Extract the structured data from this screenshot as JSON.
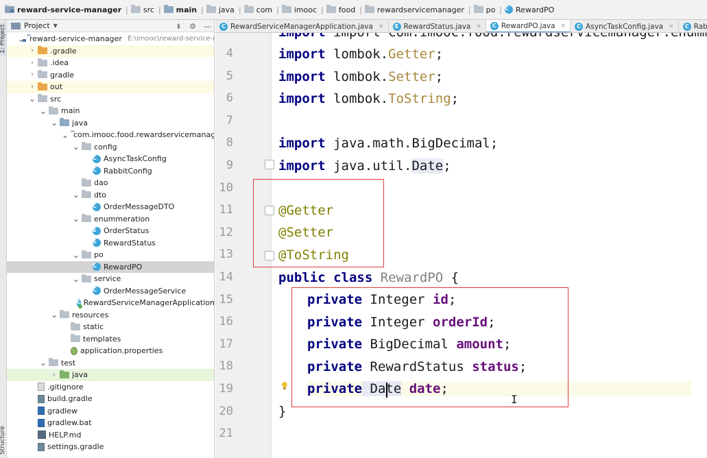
{
  "breadcrumb": [
    {
      "label": "reward-service-manager",
      "icon": "module-folder-icon"
    },
    {
      "label": "src",
      "icon": "folder-icon"
    },
    {
      "label": "main",
      "icon": "source-folder-icon"
    },
    {
      "label": "java",
      "icon": "folder-icon"
    },
    {
      "label": "com",
      "icon": "folder-icon"
    },
    {
      "label": "imooc",
      "icon": "folder-icon"
    },
    {
      "label": "food",
      "icon": "folder-icon"
    },
    {
      "label": "rewardservicemanager",
      "icon": "folder-icon"
    },
    {
      "label": "po",
      "icon": "folder-icon"
    },
    {
      "label": "RewardPO",
      "icon": "class-icon"
    }
  ],
  "sidebar_tabs": {
    "project": "1: Project",
    "structure": "Structure"
  },
  "project_panel": {
    "title": "Project",
    "tree": [
      {
        "label": "reward-service-manager",
        "hint": "E:\\imooc\\reward-service-man",
        "depth": 0,
        "arrow": "▾",
        "icon": "module"
      },
      {
        "label": ".gradle",
        "depth": 1,
        "arrow": "›",
        "icon": "orange",
        "hl": "yellow"
      },
      {
        "label": ".idea",
        "depth": 1,
        "arrow": "›",
        "icon": "folder"
      },
      {
        "label": "gradle",
        "depth": 1,
        "arrow": "›",
        "icon": "folder"
      },
      {
        "label": "out",
        "depth": 1,
        "arrow": "›",
        "icon": "orange",
        "hl": "yellow"
      },
      {
        "label": "src",
        "depth": 1,
        "arrow": "▾",
        "icon": "folder"
      },
      {
        "label": "main",
        "depth": 2,
        "arrow": "▾",
        "icon": "folder"
      },
      {
        "label": "java",
        "depth": 3,
        "arrow": "▾",
        "icon": "src"
      },
      {
        "label": "com.imooc.food.rewardservicemanager",
        "depth": 4,
        "arrow": "▾",
        "icon": "folder"
      },
      {
        "label": "config",
        "depth": 5,
        "arrow": "▾",
        "icon": "folder"
      },
      {
        "label": "AsyncTaskConfig",
        "depth": 6,
        "arrow": "",
        "icon": "class"
      },
      {
        "label": "RabbitConfig",
        "depth": 6,
        "arrow": "",
        "icon": "class"
      },
      {
        "label": "dao",
        "depth": 5,
        "arrow": "",
        "icon": "folder"
      },
      {
        "label": "dto",
        "depth": 5,
        "arrow": "▾",
        "icon": "folder"
      },
      {
        "label": "OrderMessageDTO",
        "depth": 6,
        "arrow": "",
        "icon": "class"
      },
      {
        "label": "enummeration",
        "depth": 5,
        "arrow": "▾",
        "icon": "folder"
      },
      {
        "label": "OrderStatus",
        "depth": 6,
        "arrow": "",
        "icon": "enum"
      },
      {
        "label": "RewardStatus",
        "depth": 6,
        "arrow": "",
        "icon": "enum"
      },
      {
        "label": "po",
        "depth": 5,
        "arrow": "▾",
        "icon": "folder"
      },
      {
        "label": "RewardPO",
        "depth": 6,
        "arrow": "",
        "icon": "class",
        "hl": "selected"
      },
      {
        "label": "service",
        "depth": 5,
        "arrow": "▾",
        "icon": "folder"
      },
      {
        "label": "OrderMessageService",
        "depth": 6,
        "arrow": "",
        "icon": "class"
      },
      {
        "label": "RewardServiceManagerApplication",
        "depth": 5,
        "arrow": "",
        "icon": "app"
      },
      {
        "label": "resources",
        "depth": 3,
        "arrow": "▾",
        "icon": "folder"
      },
      {
        "label": "static",
        "depth": 4,
        "arrow": "",
        "icon": "folder"
      },
      {
        "label": "templates",
        "depth": 4,
        "arrow": "",
        "icon": "folder"
      },
      {
        "label": "application.properties",
        "depth": 4,
        "arrow": "",
        "icon": "props"
      },
      {
        "label": "test",
        "depth": 2,
        "arrow": "▾",
        "icon": "folder"
      },
      {
        "label": "java",
        "depth": 3,
        "arrow": "›",
        "icon": "green",
        "hl": "green"
      },
      {
        "label": ".gitignore",
        "depth": 1,
        "arrow": "",
        "icon": "git"
      },
      {
        "label": "build.gradle",
        "depth": 1,
        "arrow": "",
        "icon": "gradle"
      },
      {
        "label": "gradlew",
        "depth": 1,
        "arrow": "",
        "icon": "gw"
      },
      {
        "label": "gradlew.bat",
        "depth": 1,
        "arrow": "",
        "icon": "gw"
      },
      {
        "label": "HELP.md",
        "depth": 1,
        "arrow": "",
        "icon": "md"
      },
      {
        "label": "settings.gradle",
        "depth": 1,
        "arrow": "",
        "icon": "gradle"
      }
    ]
  },
  "tabs": [
    {
      "label": "RewardServiceManagerApplication.java",
      "icon": "class-icon",
      "active": false
    },
    {
      "label": "RewardStatus.java",
      "icon": "enum-icon",
      "active": false
    },
    {
      "label": "RewardPO.java",
      "icon": "class-icon",
      "active": true
    },
    {
      "label": "AsyncTaskConfig.java",
      "icon": "class-icon",
      "active": false
    },
    {
      "label": "RabbitConfig.java",
      "icon": "class-icon",
      "active": false
    }
  ],
  "editor": {
    "line_numbers": [
      "4",
      "5",
      "6",
      "7",
      "8",
      "9",
      "10",
      "11",
      "12",
      "13",
      "14",
      "15",
      "16",
      "17",
      "18",
      "19",
      "20",
      "21"
    ],
    "partial_top_line": "import com.imooc.food.rewardservicemanager.enummeration.R",
    "lines": {
      "l4_kw": "import",
      "l4_pkg": " lombok.",
      "l4_cls": "Getter",
      "l4_end": ";",
      "l5_kw": "import",
      "l5_pkg": " lombok.",
      "l5_cls": "Setter",
      "l5_end": ";",
      "l6_kw": "import",
      "l6_pkg": " lombok.",
      "l6_cls": "ToString",
      "l6_end": ";",
      "l8_kw": "import",
      "l8_rest": " java.math.BigDecimal;",
      "l9_kw": "import",
      "l9_pkg": " java.util.",
      "l9_cls": "Date",
      "l9_end": ";",
      "l11": "@Getter",
      "l12": "@Setter",
      "l13": "@ToString",
      "l14_kw": "public class",
      "l14_name": " RewardPO",
      "l14_end": " {",
      "l15_kw": "private",
      "l15_type": " Integer ",
      "l15_field": "id",
      "l15_end": ";",
      "l16_kw": "private",
      "l16_type": " Integer ",
      "l16_field": "orderId",
      "l16_end": ";",
      "l17_kw": "private",
      "l17_type": " BigDecimal ",
      "l17_field": "amount",
      "l17_end": ";",
      "l18_kw": "private",
      "l18_type": " RewardStatus ",
      "l18_field": "status",
      "l18_end": ";",
      "l19_kw": "private",
      "l19_type_a": " Da",
      "l19_type_b": "te",
      "l19_field": " date",
      "l19_end": ";",
      "l20": "}"
    }
  },
  "colors": {
    "highlight_box": "#e03a3a",
    "keyword": "#000080",
    "annotation": "#808000",
    "field": "#660e7a",
    "active_tab_underline": "#4a86c7"
  }
}
